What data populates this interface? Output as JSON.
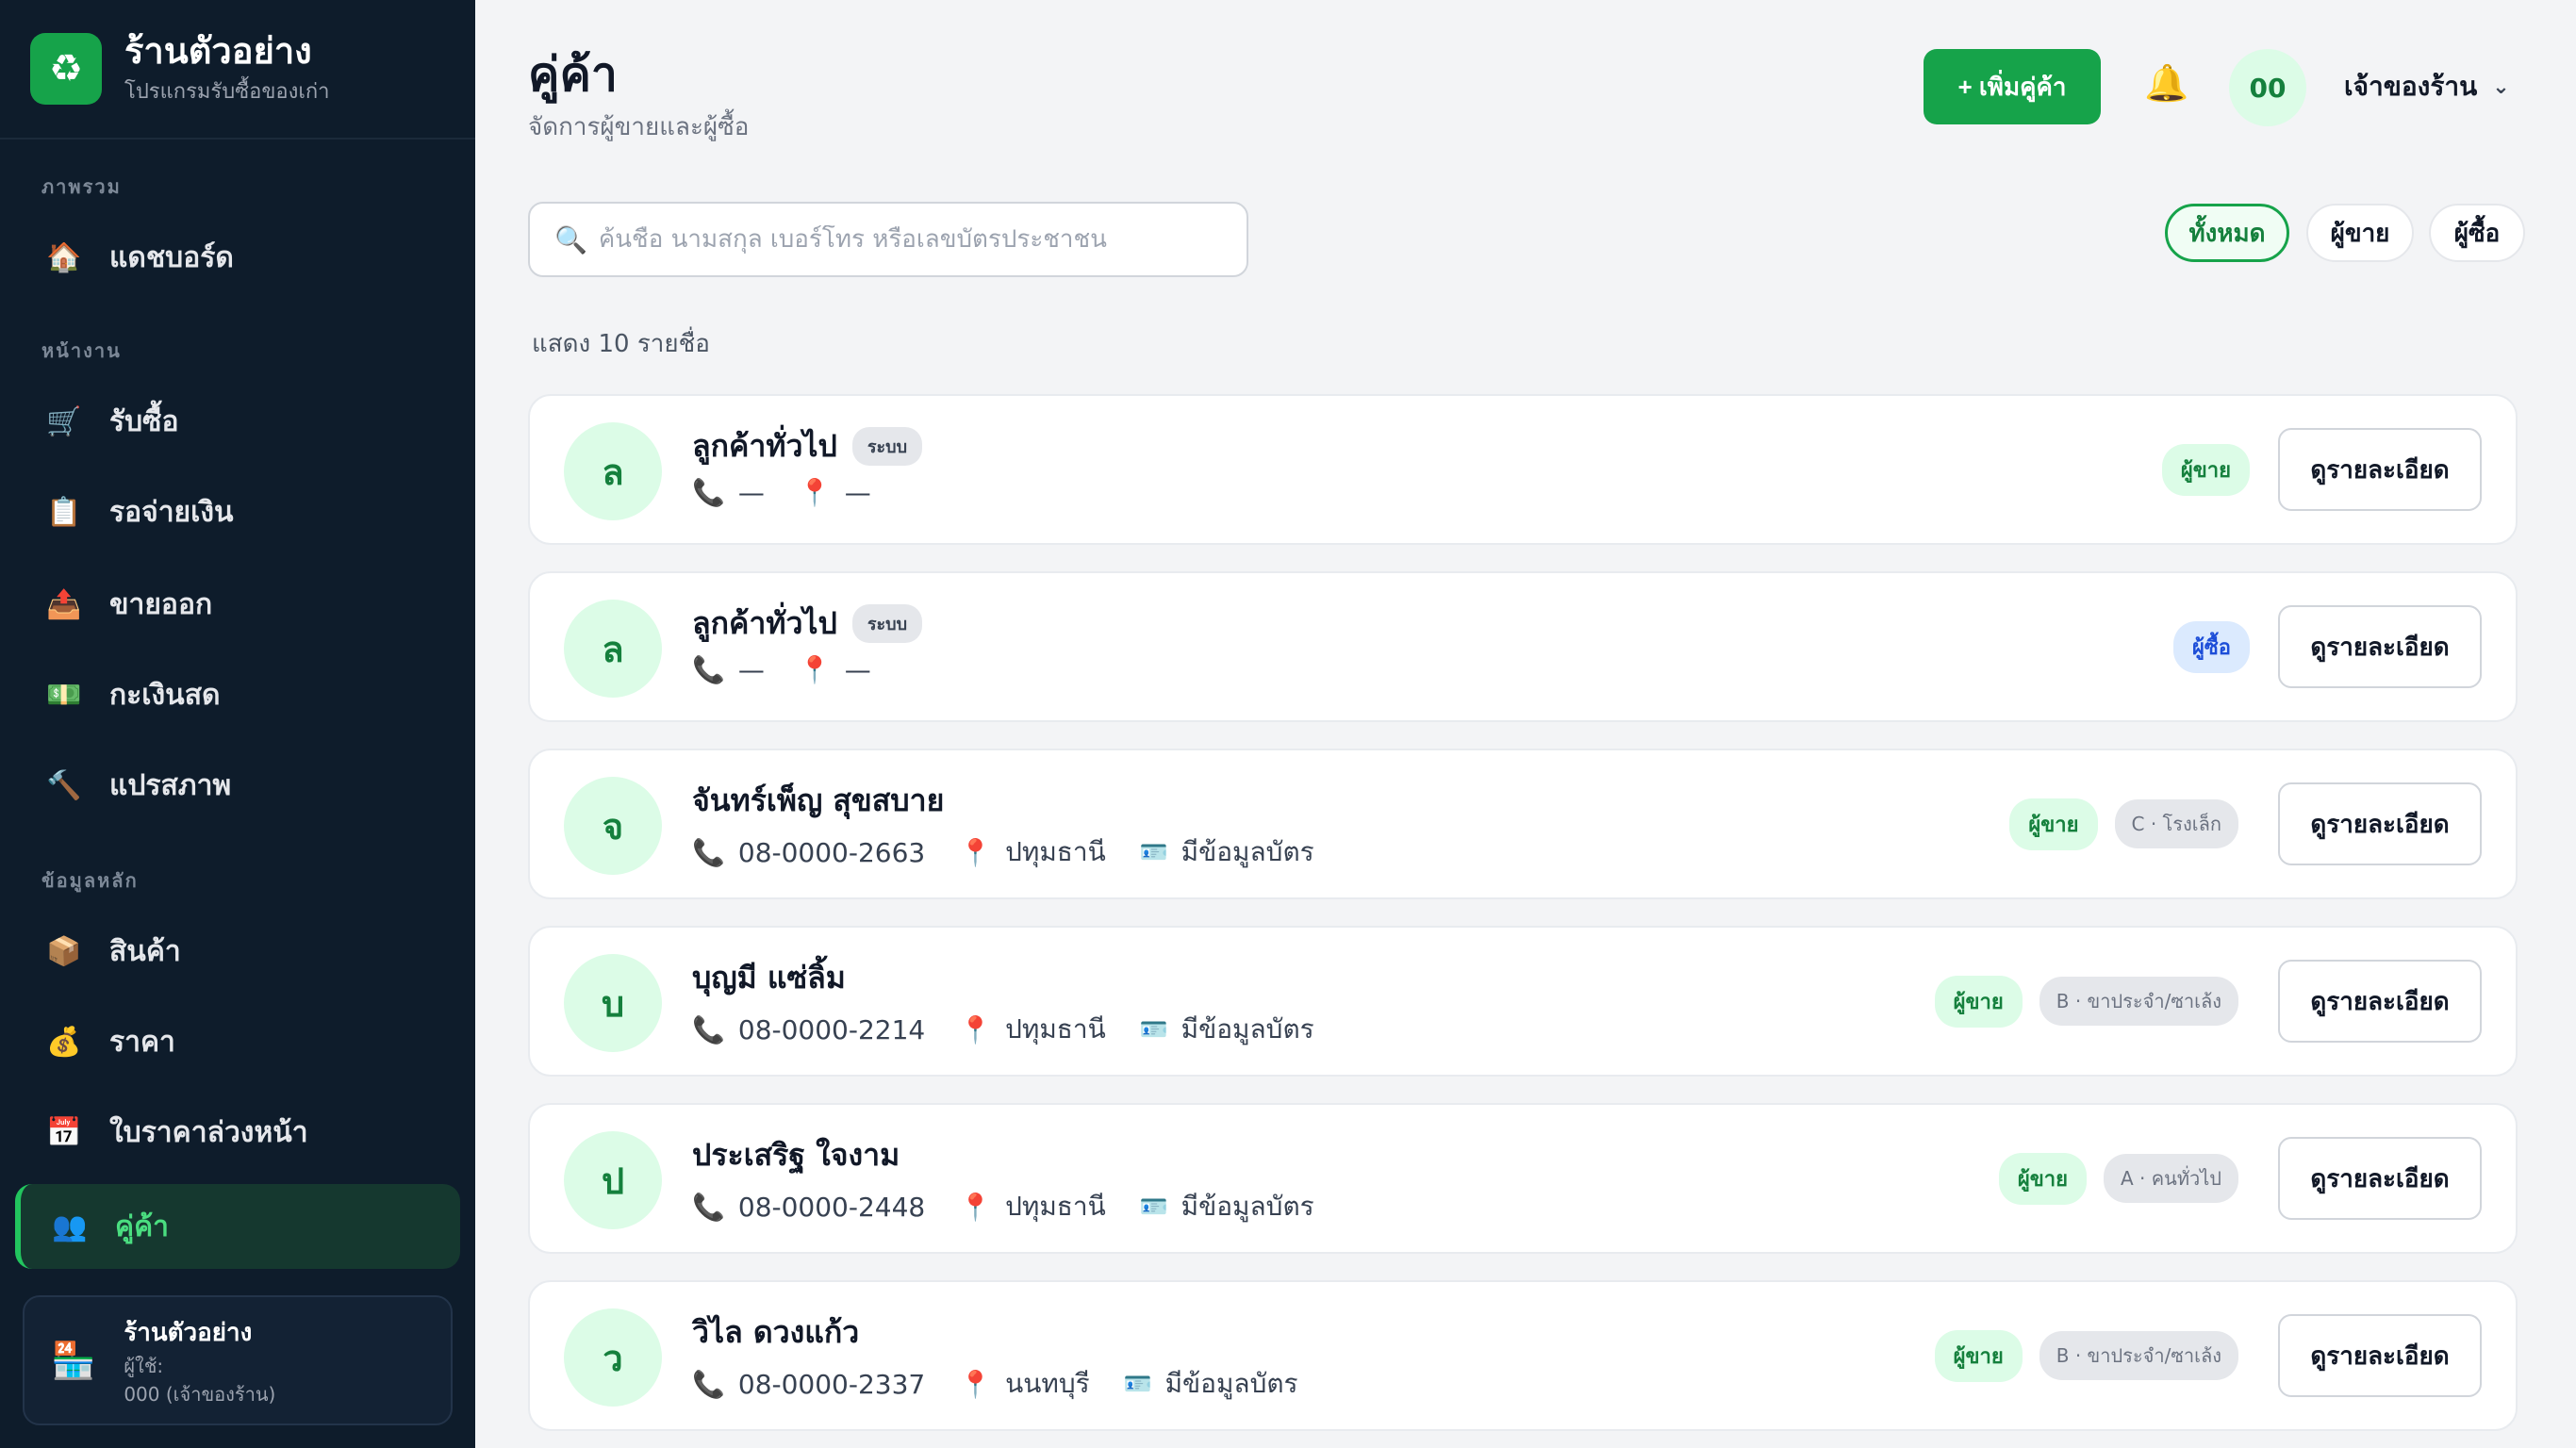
{
  "sidebar": {
    "brand": {
      "title": "ร้านตัวอย่าง",
      "subtitle": "โปรแกรมรับซื้อของเก่า"
    },
    "sections": {
      "overview": "ภาพรวม",
      "work": "หน้างาน",
      "master": "ข้อมูลหลัก"
    },
    "items": [
      {
        "label": "แดชบอร์ด",
        "icon": "house-icon"
      },
      {
        "label": "รับซื้อ",
        "icon": "cart-icon"
      },
      {
        "label": "รอจ่ายเงิน",
        "icon": "clipboard-icon"
      },
      {
        "label": "ขายออก",
        "icon": "outbox-icon"
      },
      {
        "label": "กะเงินสด",
        "icon": "cash-icon"
      },
      {
        "label": "แปรสภาพ",
        "icon": "hammer-icon"
      },
      {
        "label": "สินค้า",
        "icon": "box-icon"
      },
      {
        "label": "ราคา",
        "icon": "money-bag-icon"
      },
      {
        "label": "ใบราคาล่วงหน้า",
        "icon": "calendar-icon"
      },
      {
        "label": "คู่ค้า",
        "icon": "users-icon"
      }
    ],
    "store": {
      "name": "ร้านตัวอย่าง",
      "user_label": "ผู้ใช้:",
      "user_value": "000 (เจ้าของร้าน)"
    }
  },
  "header": {
    "title": "คู่ค้า",
    "subtitle": "จัดการผู้ขายและผู้ซื้อ",
    "add_button": "+ เพิ่มคู่ค้า",
    "avatar": "00",
    "user_role": "เจ้าของร้าน",
    "chevron": "⌄"
  },
  "search": {
    "placeholder": "ค้นชื่อ นามสกุล เบอร์โทร หรือเลขบัตรประชาชน",
    "value": ""
  },
  "filters": {
    "all": "ทั้งหมด",
    "seller": "ผู้ขาย",
    "buyer": "ผู้ซื้อ"
  },
  "count_text": "แสดง 10 รายชื่อ",
  "detail_label": "ดูรายละเอียด",
  "rows": [
    {
      "initial": "ล",
      "name": "ลูกค้าทั่วไป",
      "system": "ระบบ",
      "phone": "—",
      "province": "—",
      "type": "ผู้ขาย",
      "type_class": "seller"
    },
    {
      "initial": "ล",
      "name": "ลูกค้าทั่วไป",
      "system": "ระบบ",
      "phone": "—",
      "province": "—",
      "type": "ผู้ซื้อ",
      "type_class": "buyer"
    },
    {
      "initial": "จ",
      "name": "จันทร์เพ็ญ สุขสบาย",
      "phone": "08-0000-2663",
      "province": "ปทุมธานี",
      "card": "มีข้อมูลบัตร",
      "type": "ผู้ขาย",
      "type_class": "seller",
      "grade": "C · โรงเล็ก"
    },
    {
      "initial": "บ",
      "name": "บุญมี แซ่ลิ้ม",
      "phone": "08-0000-2214",
      "province": "ปทุมธานี",
      "card": "มีข้อมูลบัตร",
      "type": "ผู้ขาย",
      "type_class": "seller",
      "grade": "B · ขาประจำ/ซาเล้ง"
    },
    {
      "initial": "ป",
      "name": "ประเสริฐ ใจงาม",
      "phone": "08-0000-2448",
      "province": "ปทุมธานี",
      "card": "มีข้อมูลบัตร",
      "type": "ผู้ขาย",
      "type_class": "seller",
      "grade": "A · คนทั่วไป"
    },
    {
      "initial": "ว",
      "name": "วิไล ดวงแก้ว",
      "phone": "08-0000-2337",
      "province": "นนทบุรี",
      "card": "มีข้อมูลบัตร",
      "type": "ผู้ขาย",
      "type_class": "seller",
      "grade": "B · ขาประจำ/ซาเล้ง"
    }
  ],
  "colors": {
    "accent": "#16a34a",
    "sidebar_bg": "#0e1c2b",
    "page_bg": "#f3f4f6"
  }
}
